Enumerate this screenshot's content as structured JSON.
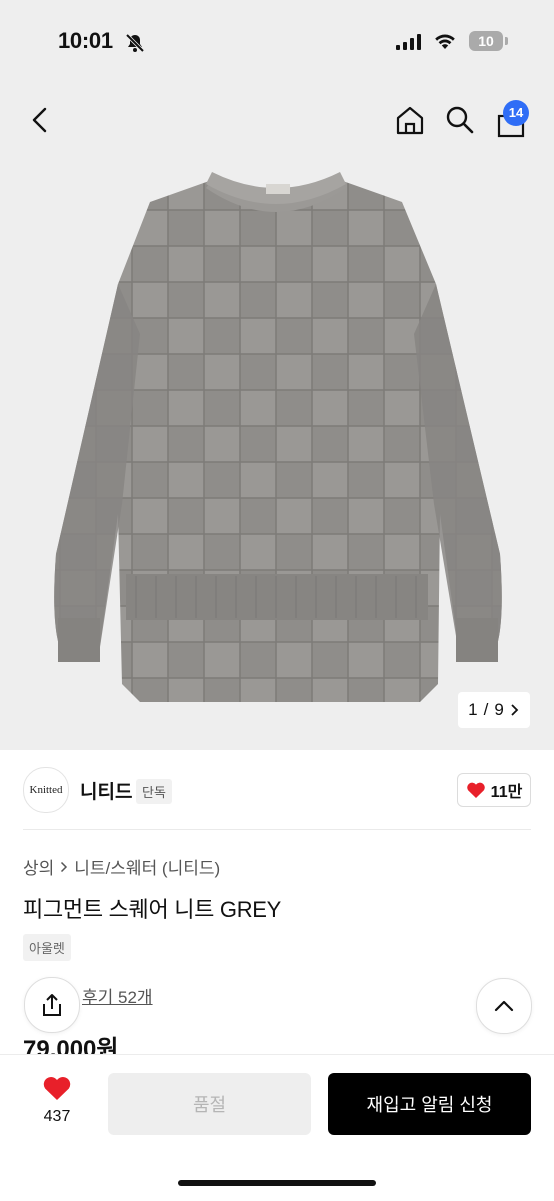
{
  "status_bar": {
    "time": "10:01",
    "battery": "10"
  },
  "header": {
    "cart_count": "14"
  },
  "gallery": {
    "current": "1",
    "separator": "/",
    "total": "9"
  },
  "brand": {
    "logo_text": "Knitted",
    "name": "니티드",
    "tag": "단독",
    "likes": "11만"
  },
  "breadcrumb": {
    "category": "상의",
    "subcategory": "니트/스웨터 (니티드)"
  },
  "product": {
    "title": "피그먼트 스퀘어 니트 GREY",
    "tag": "아울렛",
    "review_text": "후기 52개",
    "price": "79,000원"
  },
  "bottom": {
    "wish_count": "437",
    "soldout_label": "품절",
    "restock_label": "재입고 알림 신청"
  },
  "colors": {
    "accent_blue": "#2f6df6",
    "heart_red": "#e8202a",
    "sweater_grey": "#8c8a87"
  },
  "icons": [
    "back-icon",
    "home-icon",
    "search-icon",
    "cart-icon",
    "heart-icon",
    "share-icon",
    "chevron-up-icon",
    "chevron-right-icon",
    "bell-slash-icon"
  ]
}
